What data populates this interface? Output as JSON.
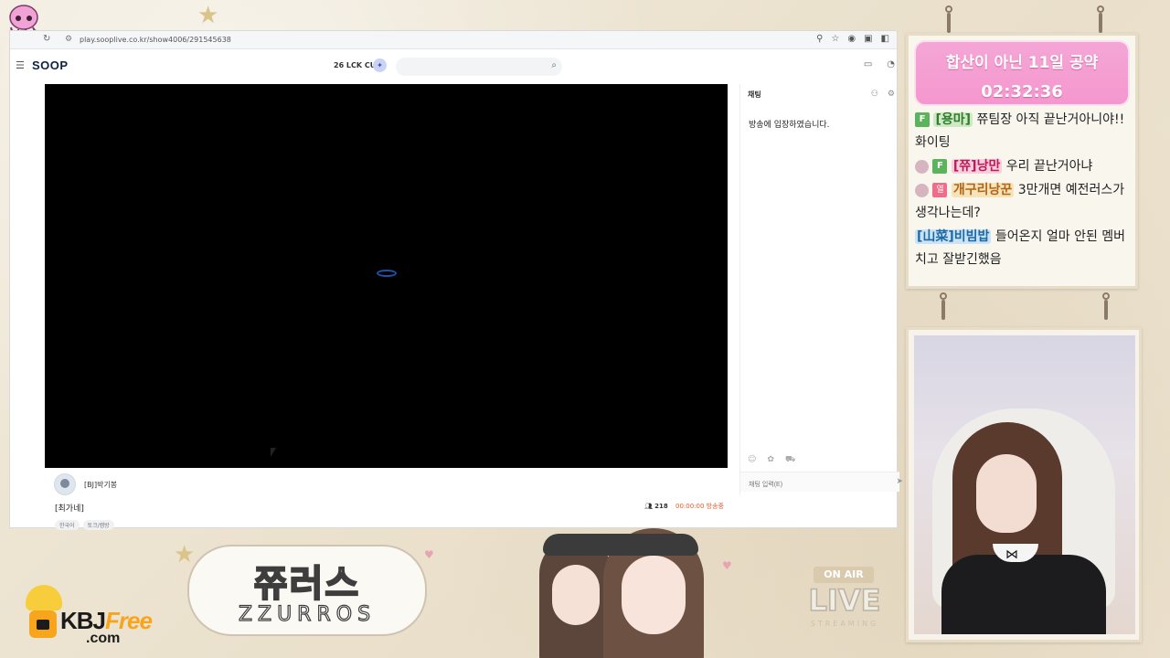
{
  "browser": {
    "url": "play.sooplive.co.kr/show4006/291545638"
  },
  "site": {
    "logo": "SOOP",
    "event_label": "26 LCK CUP",
    "search_placeholder": ""
  },
  "player": {
    "streamer_name": "[BJ]박기봉",
    "stream_title": "[최가네]",
    "viewer_count": "218",
    "elapsed": "00:00:00 방송중",
    "tags": [
      "한국어",
      "토크/캠방"
    ]
  },
  "chat_panel": {
    "title": "채팅",
    "entered_message": "방송에 입장하였습니다.",
    "input_placeholder": "채팅 입력(E)"
  },
  "overlay": {
    "banner_title": "합산이 아닌 11일 공약",
    "banner_time": "02:32:36",
    "messages": [
      {
        "badge": "F",
        "nick": "[용마]",
        "text": "쮸팀장 아직 끝난거아니야!! 화이팅"
      },
      {
        "badge": "F",
        "nick": "[쮸]낭만",
        "text": "우리 끝난거아냐"
      },
      {
        "badge": "열",
        "nick": "개구리낭꾼",
        "text": "3만개면 예전러스가 생각나는데?"
      },
      {
        "badge": "",
        "nick": "[山菜]비빔밥",
        "text": "들어온지 얼마 안된 멤버치고 잘받긴했음"
      }
    ]
  },
  "bottom": {
    "channel_name_ko": "쮸러스",
    "channel_name_en": "ZZURROS",
    "onair_tag": "ON AIR",
    "live_text": "LIVE",
    "streaming_text": "STREAMING",
    "watermark_main": "KBJ",
    "watermark_free": "Free",
    "watermark_com": ".com"
  }
}
